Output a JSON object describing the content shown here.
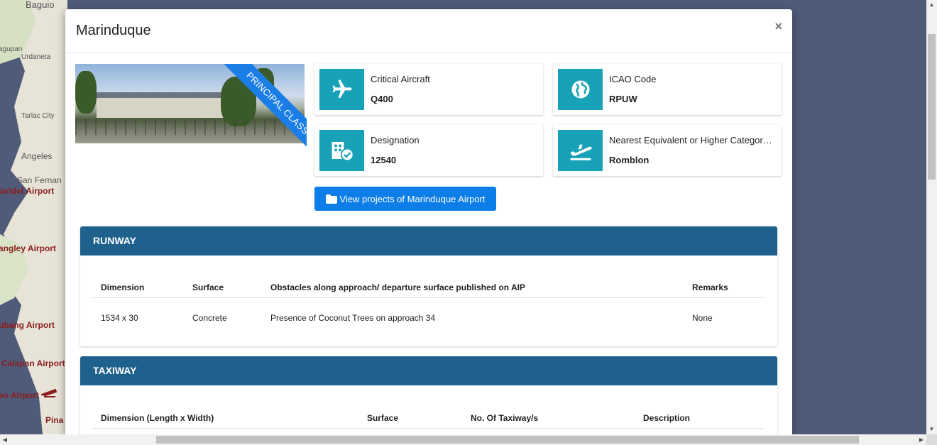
{
  "map": {
    "labels": [
      "Baguio",
      "agupan",
      "Urdaneta",
      "Tarlac City",
      "Angeles",
      "San Fernan"
    ],
    "airports": [
      "larldel Airport",
      "angley Airport",
      "ubang Airport",
      "Calapan Airport",
      "ao Airport",
      "Pina"
    ]
  },
  "modal": {
    "title": "Marinduque",
    "close_label": "×",
    "ribbon": "PRINCIPAL CLASS II",
    "cards": [
      {
        "label": "Critical Aircraft",
        "value": "Q400",
        "icon": "airplane-icon"
      },
      {
        "label": "ICAO Code",
        "value": "RPUW",
        "icon": "globe-icon"
      },
      {
        "label": "Designation",
        "value": "12540",
        "icon": "building-check-icon"
      },
      {
        "label": "Nearest Equivalent or Higher Categor…",
        "value": "Romblon",
        "icon": "plane-departure-icon"
      }
    ],
    "view_button": "View projects of Marinduque Airport",
    "runway": {
      "title": "RUNWAY",
      "headers": [
        "Dimension",
        "Surface",
        "Obstacles along approach/ departure surface published on AIP",
        "Remarks"
      ],
      "row": [
        "1534 x 30",
        "Concrete",
        "Presence of Coconut Trees on approach 34",
        "None"
      ]
    },
    "taxiway": {
      "title": "TAXIWAY",
      "headers": [
        "Dimension (Length x Width)",
        "Surface",
        "No. Of Taxiway/s",
        "Description"
      ]
    }
  },
  "colors": {
    "accent": "#17a2b8",
    "section_header": "#1f618d",
    "button": "#0d7ee8",
    "ribbon": "#1b7ee6"
  }
}
